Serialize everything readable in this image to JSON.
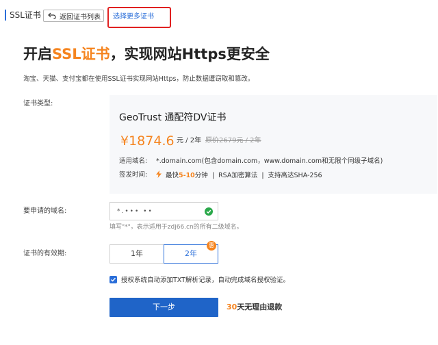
{
  "header": {
    "title": "SSL证书",
    "back_label": "返回证书列表",
    "more_label": "选择更多证书"
  },
  "hero": {
    "headline_pre": "开启",
    "headline_hl": "SSL证书",
    "headline_post": "，实现网站Https更安全",
    "subtitle": "淘宝、天猫、支付宝都在使用SSL证书实现网站Https，防止数据遭窃取和篡改。"
  },
  "labels": {
    "cert_type": "证书类型:",
    "domain": "要申请的域名:",
    "period": "证书的有效期:"
  },
  "cert": {
    "name": "GeoTrust 通配符DV证书",
    "price": "¥1874.6",
    "unit": "元 / 2年",
    "original": "原价2679元 / 2年",
    "domain_key": "适用域名:",
    "domain_val": "*.domain.com(包含domain.com，www.domain.com和无限个同级子域名)",
    "issue_key": "签发时间:",
    "issue_fast_pre": "最快",
    "issue_fast_hl": "5-10",
    "issue_fast_post": "分钟",
    "issue_rsa": "RSA加密算法",
    "issue_sha": "支持高达SHA-256"
  },
  "domain_input": {
    "value": "*.•••  ••"
  },
  "hint": "填写\"*\"，表示适用于zdj66.cn的所有二级域名。",
  "period": {
    "options": [
      "1年",
      "2年"
    ],
    "badge": "惠"
  },
  "auth_checkbox_label": "授权系统自动添加TXT解析记录，自动完成域名授权验证。",
  "next_label": "下一步",
  "refund": {
    "num": "30",
    "text": "天无理由退款"
  },
  "colors": {
    "accent": "#2a6ed9",
    "highlight": "#f5841f",
    "primary_button": "#1f64c8",
    "alert_border": "#e02020",
    "check_ok": "#2aa84a"
  }
}
